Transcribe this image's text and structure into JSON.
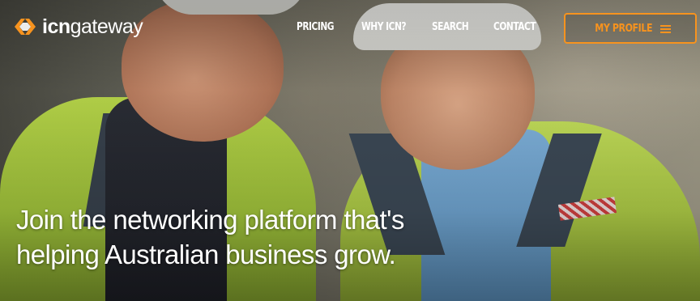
{
  "brand": {
    "name_bold": "icn",
    "name_light": "gateway",
    "logo_icon": "icn-chevrons-logo-icon",
    "accent_color": "#f7931e"
  },
  "nav": {
    "items": [
      {
        "label": "PRICING"
      },
      {
        "label": "WHY ICN?"
      },
      {
        "label": "SEARCH"
      },
      {
        "label": "CONTACT"
      }
    ],
    "profile_button": {
      "label": "MY PROFILE",
      "icon": "hamburger-menu-icon"
    }
  },
  "hero": {
    "image_description_icon": "workers-photo",
    "tagline_line1": "Join the networking platform that's",
    "tagline_line2": "helping Australian business grow."
  }
}
